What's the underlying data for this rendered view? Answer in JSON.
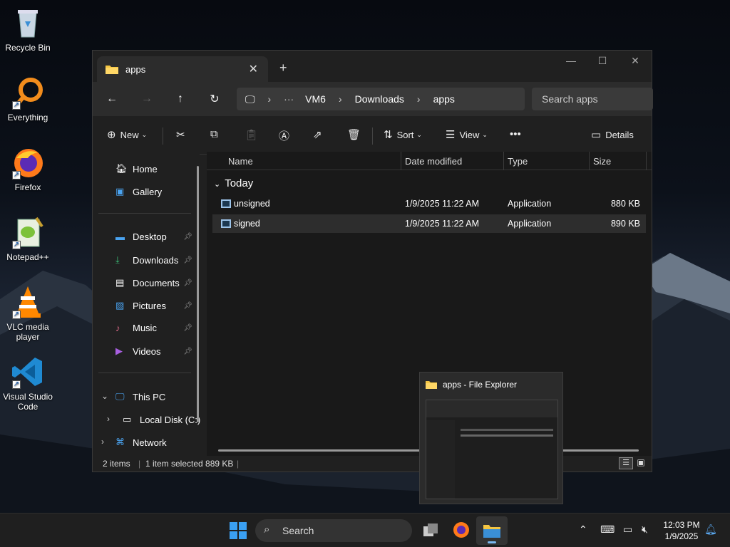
{
  "desktop": {
    "icons": [
      {
        "label": "Recycle Bin"
      },
      {
        "label": "Everything"
      },
      {
        "label": "Firefox"
      },
      {
        "label": "Notepad++"
      },
      {
        "label": "VLC media player"
      },
      {
        "label": "Visual Studio Code"
      }
    ]
  },
  "window": {
    "tab_title": "apps",
    "breadcrumb": [
      "VM6",
      "Downloads",
      "apps"
    ],
    "search_placeholder": "Search apps",
    "toolbar": {
      "new": "New",
      "sort": "Sort",
      "view": "View",
      "details": "Details"
    },
    "nav": {
      "home": "Home",
      "gallery": "Gallery",
      "desktop": "Desktop",
      "downloads": "Downloads",
      "documents": "Documents",
      "pictures": "Pictures",
      "music": "Music",
      "videos": "Videos",
      "this_pc": "This PC",
      "local_disk": "Local Disk (C:)",
      "network": "Network"
    },
    "columns": [
      "Name",
      "Date modified",
      "Type",
      "Size"
    ],
    "group": "Today",
    "files": [
      {
        "name": "unsigned",
        "date": "1/9/2025 11:22 AM",
        "type": "Application",
        "size": "880 KB"
      },
      {
        "name": "signed",
        "date": "1/9/2025 11:22 AM",
        "type": "Application",
        "size": "890 KB"
      }
    ],
    "status": {
      "count": "2 items",
      "selected": "1 item selected  889 KB"
    }
  },
  "preview": {
    "title": "apps - File Explorer"
  },
  "taskbar": {
    "search": "Search",
    "time": "12:03 PM",
    "date": "1/9/2025"
  }
}
